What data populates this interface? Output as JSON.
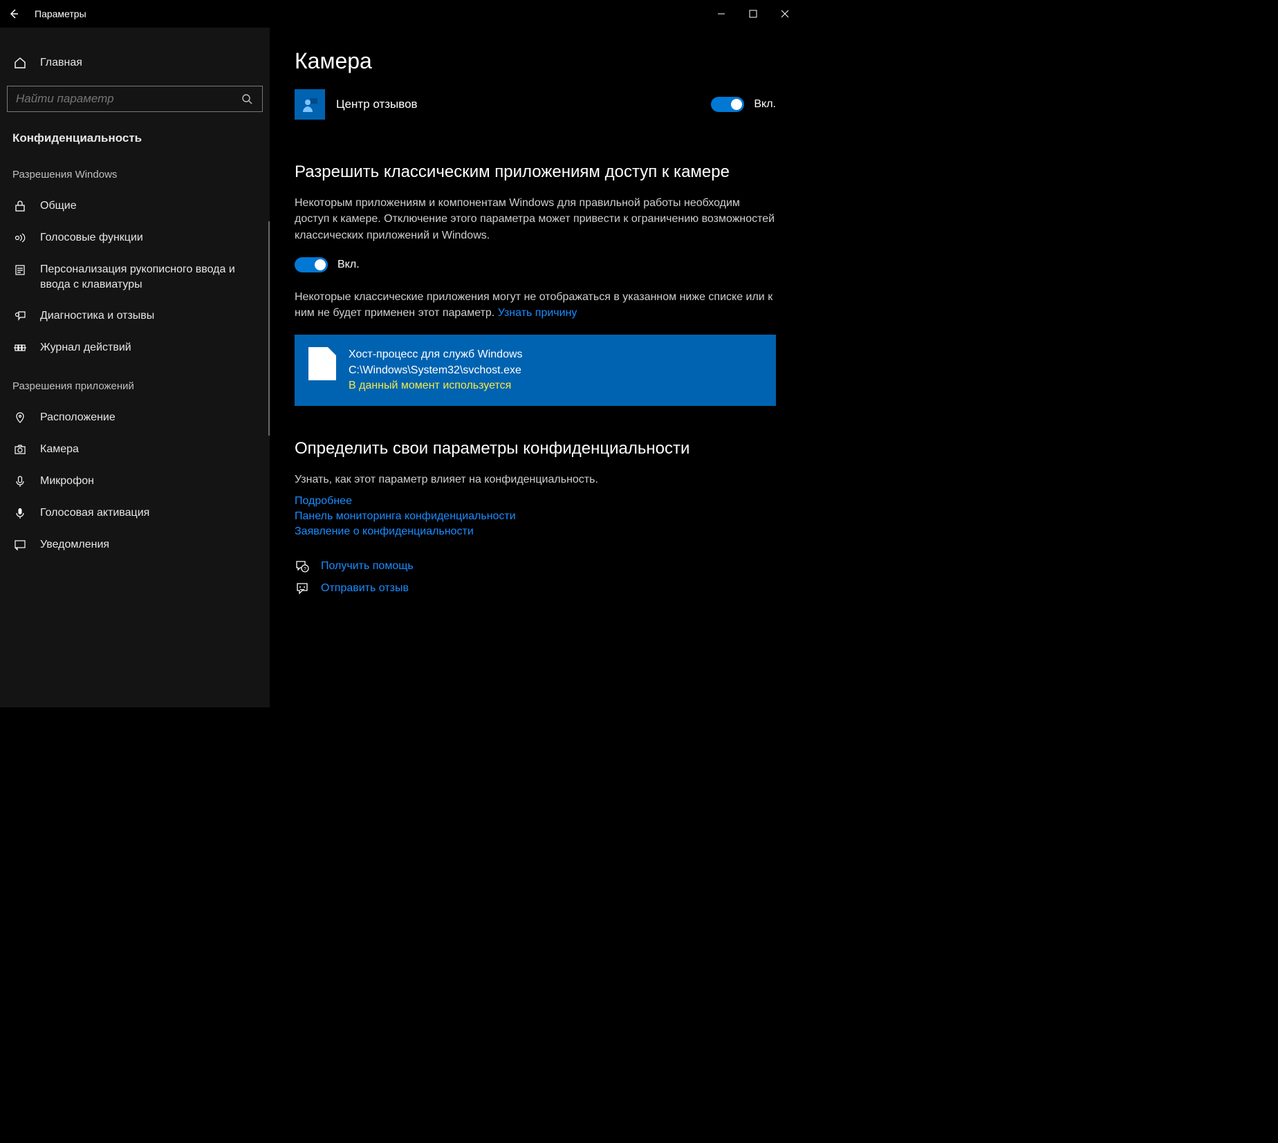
{
  "window": {
    "title": "Параметры"
  },
  "sidebar": {
    "home": "Главная",
    "search_placeholder": "Найти параметр",
    "section": "Конфиденциальность",
    "group1": "Разрешения Windows",
    "items1": [
      {
        "label": "Общие"
      },
      {
        "label": "Голосовые функции"
      },
      {
        "label": "Персонализация рукописного ввода и ввода с клавиатуры"
      },
      {
        "label": "Диагностика и отзывы"
      },
      {
        "label": "Журнал действий"
      }
    ],
    "group2": "Разрешения приложений",
    "items2": [
      {
        "label": "Расположение"
      },
      {
        "label": "Камера"
      },
      {
        "label": "Микрофон"
      },
      {
        "label": "Голосовая активация"
      },
      {
        "label": "Уведомления"
      }
    ]
  },
  "main": {
    "title": "Камера",
    "feedback_app": "Центр отзывов",
    "toggle_on": "Вкл.",
    "section2_title": "Разрешить классическим приложениям доступ к камере",
    "section2_desc": "Некоторым приложениям и компонентам Windows для правильной работы необходим доступ к камере. Отключение этого параметра может привести к ограничению возможностей классических приложений и Windows.",
    "info_text": "Некоторые классические приложения могут не отображаться в указанном ниже списке или к ним не будет применен этот параметр. ",
    "info_link": "Узнать причину",
    "card_name": "Хост-процесс для служб Windows",
    "card_path": "C:\\Windows\\System32\\svchost.exe",
    "card_status": "В данный момент используется",
    "section3_title": "Определить свои параметры конфиденциальности",
    "section3_desc": "Узнать, как этот параметр влияет на конфиденциальность.",
    "links": {
      "learn_more": "Подробнее",
      "dashboard": "Панель мониторинга конфиденциальности",
      "statement": "Заявление о конфиденциальности"
    },
    "help": "Получить помощь",
    "send_feedback": "Отправить отзыв"
  }
}
